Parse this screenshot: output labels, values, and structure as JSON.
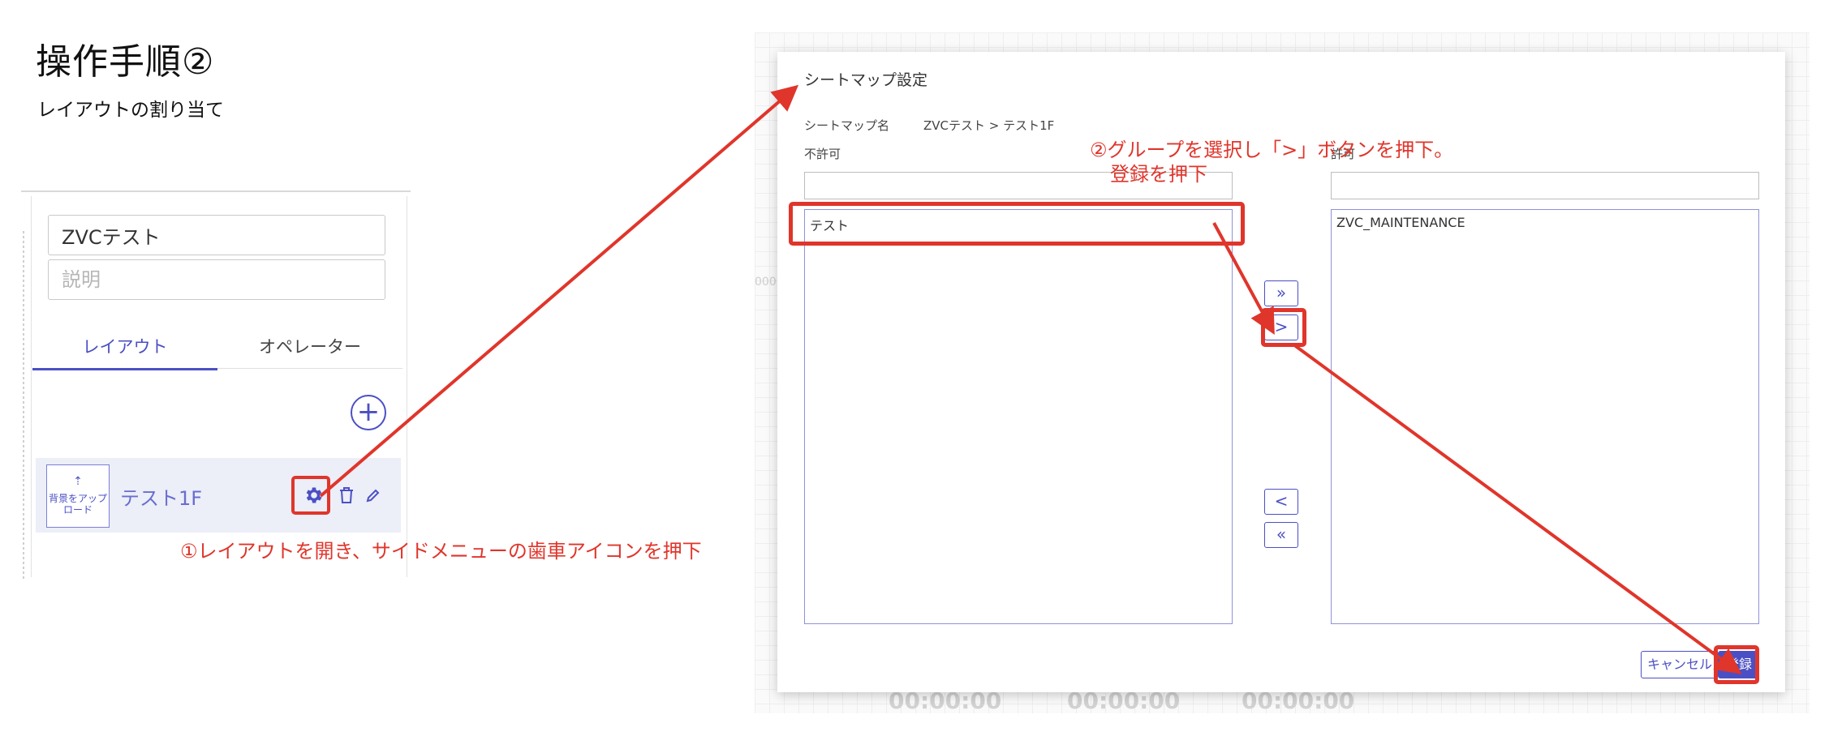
{
  "doc": {
    "title": "操作手順②",
    "subtitle": "レイアウトの割り当て"
  },
  "sidebar": {
    "name_value": "ZVCテスト",
    "description_placeholder": "説明",
    "tabs": [
      {
        "label": "レイアウト",
        "active": true
      },
      {
        "label": "オペレーター",
        "active": false
      }
    ],
    "add_icon": "plus-circle-icon",
    "layout_item": {
      "thumbnail_text": "背景をアップロード",
      "name": "テスト1F"
    }
  },
  "annotations": {
    "step1": "①レイアウトを開き、サイドメニューの歯車アイコンを押下",
    "step2_line1": "②グループを選択し「>」ボタンを押下。",
    "step2_line2": "登録を押下"
  },
  "dialog": {
    "title": "シートマップ設定",
    "seatmap_name_label": "シートマップ名",
    "seatmap_name_value": "ZVCテスト > テスト1F",
    "deny_label": "不許可",
    "allow_label": "許可",
    "deny_items": [
      "テスト"
    ],
    "allow_items": [
      "ZVC_MAINTENANCE"
    ],
    "buttons": {
      "move_all_right": "»",
      "move_right": ">",
      "move_left": "<",
      "move_all_left": "«",
      "cancel": "キャンセル",
      "register": "登録"
    }
  },
  "colors": {
    "accent": "#4b4fc4",
    "annotation_red": "#e0352b"
  }
}
